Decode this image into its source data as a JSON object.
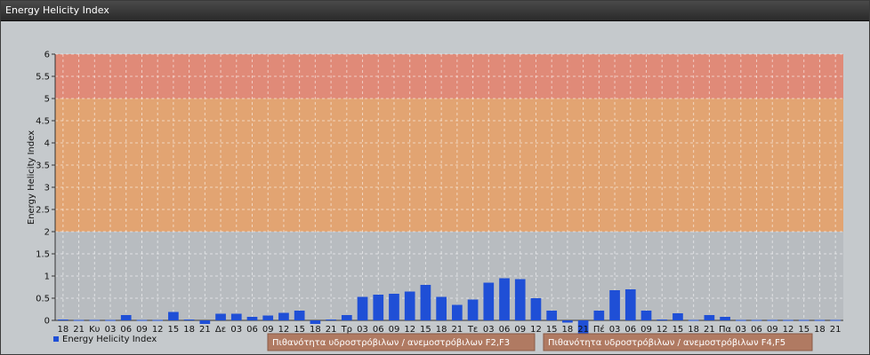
{
  "window": {
    "title": "Energy Helicity Index"
  },
  "chart_data": {
    "type": "bar",
    "ylabel": "Energy Helicity Index",
    "ylim": [
      0,
      6
    ],
    "yticks": [
      "0",
      "0.5",
      "1",
      "1.5",
      "2",
      "2.5",
      "3",
      "3.5",
      "4",
      "4.5",
      "5",
      "5.5",
      "6"
    ],
    "grid": true,
    "bar_color": "#1f4fd6",
    "zones": [
      {
        "from": 0,
        "to": 2,
        "color": "#b8bcc0"
      },
      {
        "from": 2,
        "to": 5,
        "color": "#e2a472"
      },
      {
        "from": 5,
        "to": 6,
        "color": "#e08a78"
      }
    ],
    "categories": [
      "18",
      "21",
      "Κυ",
      "03",
      "06",
      "09",
      "12",
      "15",
      "18",
      "21",
      "Δε",
      "03",
      "06",
      "09",
      "12",
      "15",
      "18",
      "21",
      "Τρ",
      "03",
      "06",
      "09",
      "12",
      "15",
      "18",
      "21",
      "Τε",
      "03",
      "06",
      "09",
      "12",
      "15",
      "18",
      "21",
      "Πέ",
      "03",
      "06",
      "09",
      "12",
      "15",
      "18",
      "21",
      "Πα",
      "03",
      "06",
      "09",
      "12",
      "15",
      "18",
      "21"
    ],
    "series": [
      {
        "name": "Energy Helicity Index",
        "values": [
          0.02,
          0.01,
          0.01,
          0.01,
          0.12,
          0.01,
          0.01,
          0.19,
          0.02,
          -0.08,
          0.15,
          0.15,
          0.08,
          0.11,
          0.17,
          0.22,
          -0.08,
          0.02,
          0.12,
          0.53,
          0.58,
          0.6,
          0.65,
          0.8,
          0.53,
          0.35,
          0.47,
          0.85,
          0.95,
          0.93,
          0.5,
          0.22,
          -0.05,
          -0.5,
          0.22,
          0.68,
          0.7,
          0.22,
          0.02,
          0.16,
          0.01,
          0.12,
          0.08,
          0.01,
          0.01,
          0.01,
          0.01,
          0.01,
          0.01,
          0.01
        ]
      }
    ],
    "legend": {
      "label": "Energy Helicity Index",
      "position": "bottom-left"
    },
    "bands": [
      "Πιθανότητα υδροστρόβιλων / ανεμοστρόβιλων F2,F3",
      "Πιθανότητα υδροστρόβιλων / ανεμοστρόβιλων F4,F5"
    ]
  }
}
